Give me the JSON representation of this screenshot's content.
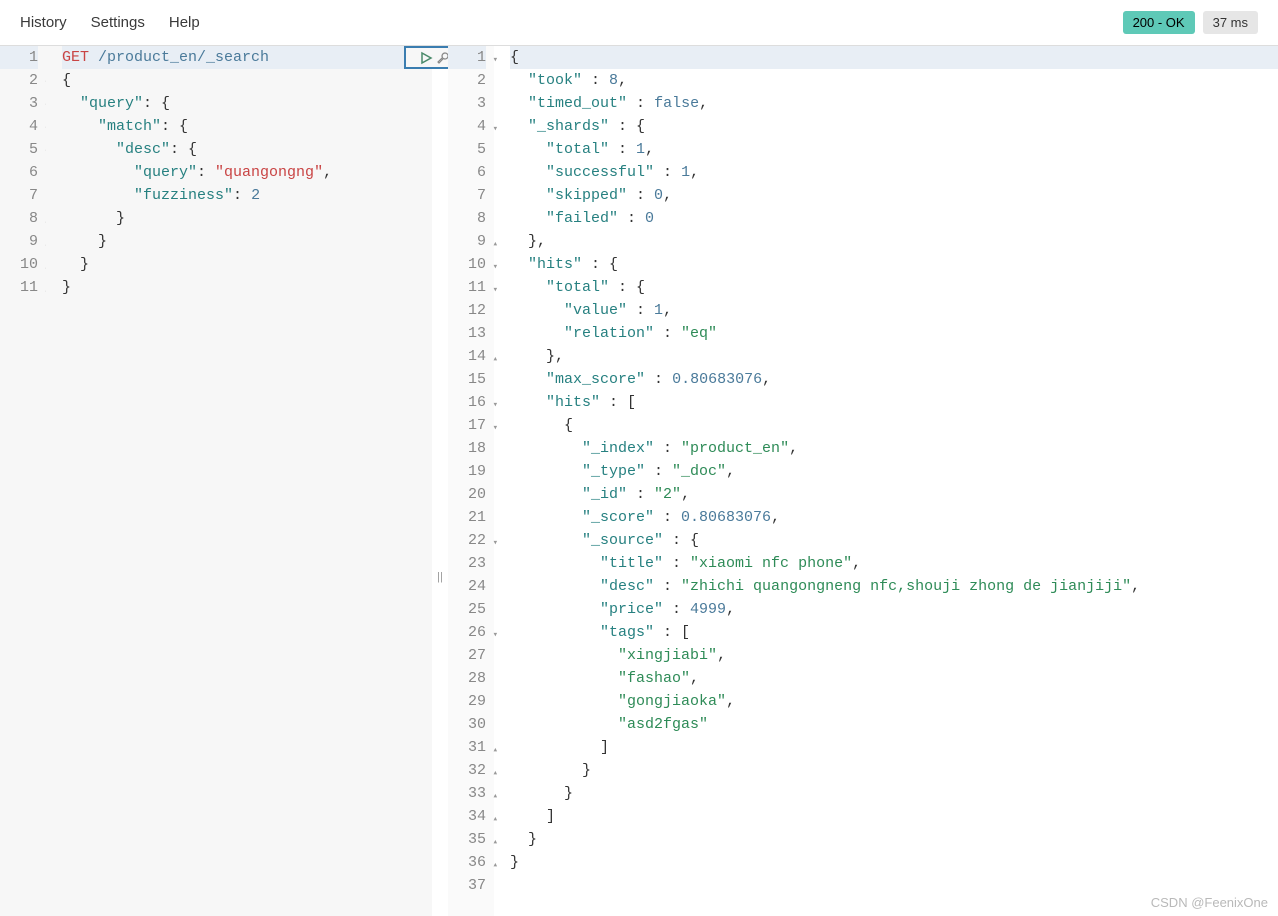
{
  "menu": {
    "history": "History",
    "settings": "Settings",
    "help": "Help"
  },
  "status": {
    "code": "200 - OK",
    "time": "37 ms"
  },
  "request": {
    "method": "GET",
    "url": "/product_en/_search",
    "lines": [
      {
        "num": 1,
        "fold": "",
        "tokens": [
          {
            "t": "GET ",
            "c": "method"
          },
          {
            "t": "/product_en/_search",
            "c": "url"
          }
        ]
      },
      {
        "num": 2,
        "fold": "▾",
        "tokens": [
          {
            "t": "{",
            "c": "brace"
          }
        ]
      },
      {
        "num": 3,
        "fold": "▾",
        "tokens": [
          {
            "t": "  ",
            "c": ""
          },
          {
            "t": "\"query\"",
            "c": "key"
          },
          {
            "t": ": {",
            "c": "brace"
          }
        ]
      },
      {
        "num": 4,
        "fold": "▾",
        "tokens": [
          {
            "t": "    ",
            "c": ""
          },
          {
            "t": "\"match\"",
            "c": "key"
          },
          {
            "t": ": {",
            "c": "brace"
          }
        ]
      },
      {
        "num": 5,
        "fold": "▾",
        "tokens": [
          {
            "t": "      ",
            "c": ""
          },
          {
            "t": "\"desc\"",
            "c": "key"
          },
          {
            "t": ": {",
            "c": "brace"
          }
        ]
      },
      {
        "num": 6,
        "fold": "",
        "tokens": [
          {
            "t": "        ",
            "c": ""
          },
          {
            "t": "\"query\"",
            "c": "key"
          },
          {
            "t": ": ",
            "c": "brace"
          },
          {
            "t": "\"quangongng\"",
            "c": "string"
          },
          {
            "t": ",",
            "c": "brace"
          }
        ]
      },
      {
        "num": 7,
        "fold": "",
        "tokens": [
          {
            "t": "        ",
            "c": ""
          },
          {
            "t": "\"fuzziness\"",
            "c": "key"
          },
          {
            "t": ": ",
            "c": "brace"
          },
          {
            "t": "2",
            "c": "number"
          }
        ]
      },
      {
        "num": 8,
        "fold": "▴",
        "tokens": [
          {
            "t": "      }",
            "c": "brace"
          }
        ]
      },
      {
        "num": 9,
        "fold": "▴",
        "tokens": [
          {
            "t": "    }",
            "c": "brace"
          }
        ]
      },
      {
        "num": 10,
        "fold": "▴",
        "tokens": [
          {
            "t": "  }",
            "c": "brace"
          }
        ]
      },
      {
        "num": 11,
        "fold": "▴",
        "tokens": [
          {
            "t": "}",
            "c": "brace"
          }
        ]
      }
    ]
  },
  "response": {
    "lines": [
      {
        "num": 1,
        "fold": "▾",
        "tokens": [
          {
            "t": "{",
            "c": "brace"
          }
        ]
      },
      {
        "num": 2,
        "fold": "",
        "tokens": [
          {
            "t": "  ",
            "c": ""
          },
          {
            "t": "\"took\"",
            "c": "key"
          },
          {
            "t": " : ",
            "c": "brace"
          },
          {
            "t": "8",
            "c": "number"
          },
          {
            "t": ",",
            "c": "brace"
          }
        ]
      },
      {
        "num": 3,
        "fold": "",
        "tokens": [
          {
            "t": "  ",
            "c": ""
          },
          {
            "t": "\"timed_out\"",
            "c": "key"
          },
          {
            "t": " : ",
            "c": "brace"
          },
          {
            "t": "false",
            "c": "bool"
          },
          {
            "t": ",",
            "c": "brace"
          }
        ]
      },
      {
        "num": 4,
        "fold": "▾",
        "tokens": [
          {
            "t": "  ",
            "c": ""
          },
          {
            "t": "\"_shards\"",
            "c": "key"
          },
          {
            "t": " : {",
            "c": "brace"
          }
        ]
      },
      {
        "num": 5,
        "fold": "",
        "tokens": [
          {
            "t": "    ",
            "c": ""
          },
          {
            "t": "\"total\"",
            "c": "key"
          },
          {
            "t": " : ",
            "c": "brace"
          },
          {
            "t": "1",
            "c": "number"
          },
          {
            "t": ",",
            "c": "brace"
          }
        ]
      },
      {
        "num": 6,
        "fold": "",
        "tokens": [
          {
            "t": "    ",
            "c": ""
          },
          {
            "t": "\"successful\"",
            "c": "key"
          },
          {
            "t": " : ",
            "c": "brace"
          },
          {
            "t": "1",
            "c": "number"
          },
          {
            "t": ",",
            "c": "brace"
          }
        ]
      },
      {
        "num": 7,
        "fold": "",
        "tokens": [
          {
            "t": "    ",
            "c": ""
          },
          {
            "t": "\"skipped\"",
            "c": "key"
          },
          {
            "t": " : ",
            "c": "brace"
          },
          {
            "t": "0",
            "c": "number"
          },
          {
            "t": ",",
            "c": "brace"
          }
        ]
      },
      {
        "num": 8,
        "fold": "",
        "tokens": [
          {
            "t": "    ",
            "c": ""
          },
          {
            "t": "\"failed\"",
            "c": "key"
          },
          {
            "t": " : ",
            "c": "brace"
          },
          {
            "t": "0",
            "c": "number"
          }
        ]
      },
      {
        "num": 9,
        "fold": "▴",
        "tokens": [
          {
            "t": "  },",
            "c": "brace"
          }
        ]
      },
      {
        "num": 10,
        "fold": "▾",
        "tokens": [
          {
            "t": "  ",
            "c": ""
          },
          {
            "t": "\"hits\"",
            "c": "key"
          },
          {
            "t": " : {",
            "c": "brace"
          }
        ]
      },
      {
        "num": 11,
        "fold": "▾",
        "tokens": [
          {
            "t": "    ",
            "c": ""
          },
          {
            "t": "\"total\"",
            "c": "key"
          },
          {
            "t": " : {",
            "c": "brace"
          }
        ]
      },
      {
        "num": 12,
        "fold": "",
        "tokens": [
          {
            "t": "      ",
            "c": ""
          },
          {
            "t": "\"value\"",
            "c": "key"
          },
          {
            "t": " : ",
            "c": "brace"
          },
          {
            "t": "1",
            "c": "number"
          },
          {
            "t": ",",
            "c": "brace"
          }
        ]
      },
      {
        "num": 13,
        "fold": "",
        "tokens": [
          {
            "t": "      ",
            "c": ""
          },
          {
            "t": "\"relation\"",
            "c": "key"
          },
          {
            "t": " : ",
            "c": "brace"
          },
          {
            "t": "\"eq\"",
            "c": "string-green"
          }
        ]
      },
      {
        "num": 14,
        "fold": "▴",
        "tokens": [
          {
            "t": "    },",
            "c": "brace"
          }
        ]
      },
      {
        "num": 15,
        "fold": "",
        "tokens": [
          {
            "t": "    ",
            "c": ""
          },
          {
            "t": "\"max_score\"",
            "c": "key"
          },
          {
            "t": " : ",
            "c": "brace"
          },
          {
            "t": "0.80683076",
            "c": "number"
          },
          {
            "t": ",",
            "c": "brace"
          }
        ]
      },
      {
        "num": 16,
        "fold": "▾",
        "tokens": [
          {
            "t": "    ",
            "c": ""
          },
          {
            "t": "\"hits\"",
            "c": "key"
          },
          {
            "t": " : [",
            "c": "brace"
          }
        ]
      },
      {
        "num": 17,
        "fold": "▾",
        "tokens": [
          {
            "t": "      {",
            "c": "brace"
          }
        ]
      },
      {
        "num": 18,
        "fold": "",
        "tokens": [
          {
            "t": "        ",
            "c": ""
          },
          {
            "t": "\"_index\"",
            "c": "key"
          },
          {
            "t": " : ",
            "c": "brace"
          },
          {
            "t": "\"product_en\"",
            "c": "string-green"
          },
          {
            "t": ",",
            "c": "brace"
          }
        ]
      },
      {
        "num": 19,
        "fold": "",
        "tokens": [
          {
            "t": "        ",
            "c": ""
          },
          {
            "t": "\"_type\"",
            "c": "key"
          },
          {
            "t": " : ",
            "c": "brace"
          },
          {
            "t": "\"_doc\"",
            "c": "string-green"
          },
          {
            "t": ",",
            "c": "brace"
          }
        ]
      },
      {
        "num": 20,
        "fold": "",
        "tokens": [
          {
            "t": "        ",
            "c": ""
          },
          {
            "t": "\"_id\"",
            "c": "key"
          },
          {
            "t": " : ",
            "c": "brace"
          },
          {
            "t": "\"2\"",
            "c": "string-green"
          },
          {
            "t": ",",
            "c": "brace"
          }
        ]
      },
      {
        "num": 21,
        "fold": "",
        "tokens": [
          {
            "t": "        ",
            "c": ""
          },
          {
            "t": "\"_score\"",
            "c": "key"
          },
          {
            "t": " : ",
            "c": "brace"
          },
          {
            "t": "0.80683076",
            "c": "number"
          },
          {
            "t": ",",
            "c": "brace"
          }
        ]
      },
      {
        "num": 22,
        "fold": "▾",
        "tokens": [
          {
            "t": "        ",
            "c": ""
          },
          {
            "t": "\"_source\"",
            "c": "key"
          },
          {
            "t": " : {",
            "c": "brace"
          }
        ]
      },
      {
        "num": 23,
        "fold": "",
        "tokens": [
          {
            "t": "          ",
            "c": ""
          },
          {
            "t": "\"title\"",
            "c": "key"
          },
          {
            "t": " : ",
            "c": "brace"
          },
          {
            "t": "\"xiaomi nfc phone\"",
            "c": "string-green"
          },
          {
            "t": ",",
            "c": "brace"
          }
        ]
      },
      {
        "num": 24,
        "fold": "",
        "tokens": [
          {
            "t": "          ",
            "c": ""
          },
          {
            "t": "\"desc\"",
            "c": "key"
          },
          {
            "t": " : ",
            "c": "brace"
          },
          {
            "t": "\"zhichi quangongneng nfc,shouji zhong de jianjiji\"",
            "c": "string-green"
          },
          {
            "t": ",",
            "c": "brace"
          }
        ]
      },
      {
        "num": 25,
        "fold": "",
        "tokens": [
          {
            "t": "          ",
            "c": ""
          },
          {
            "t": "\"price\"",
            "c": "key"
          },
          {
            "t": " : ",
            "c": "brace"
          },
          {
            "t": "4999",
            "c": "number"
          },
          {
            "t": ",",
            "c": "brace"
          }
        ]
      },
      {
        "num": 26,
        "fold": "▾",
        "tokens": [
          {
            "t": "          ",
            "c": ""
          },
          {
            "t": "\"tags\"",
            "c": "key"
          },
          {
            "t": " : [",
            "c": "brace"
          }
        ]
      },
      {
        "num": 27,
        "fold": "",
        "tokens": [
          {
            "t": "            ",
            "c": ""
          },
          {
            "t": "\"xingjiabi\"",
            "c": "string-green"
          },
          {
            "t": ",",
            "c": "brace"
          }
        ]
      },
      {
        "num": 28,
        "fold": "",
        "tokens": [
          {
            "t": "            ",
            "c": ""
          },
          {
            "t": "\"fashao\"",
            "c": "string-green"
          },
          {
            "t": ",",
            "c": "brace"
          }
        ]
      },
      {
        "num": 29,
        "fold": "",
        "tokens": [
          {
            "t": "            ",
            "c": ""
          },
          {
            "t": "\"gongjiaoka\"",
            "c": "string-green"
          },
          {
            "t": ",",
            "c": "brace"
          }
        ]
      },
      {
        "num": 30,
        "fold": "",
        "tokens": [
          {
            "t": "            ",
            "c": ""
          },
          {
            "t": "\"asd2fgas\"",
            "c": "string-green"
          }
        ]
      },
      {
        "num": 31,
        "fold": "▴",
        "tokens": [
          {
            "t": "          ]",
            "c": "brace"
          }
        ]
      },
      {
        "num": 32,
        "fold": "▴",
        "tokens": [
          {
            "t": "        }",
            "c": "brace"
          }
        ]
      },
      {
        "num": 33,
        "fold": "▴",
        "tokens": [
          {
            "t": "      }",
            "c": "brace"
          }
        ]
      },
      {
        "num": 34,
        "fold": "▴",
        "tokens": [
          {
            "t": "    ]",
            "c": "brace"
          }
        ]
      },
      {
        "num": 35,
        "fold": "▴",
        "tokens": [
          {
            "t": "  }",
            "c": "brace"
          }
        ]
      },
      {
        "num": 36,
        "fold": "▴",
        "tokens": [
          {
            "t": "}",
            "c": "brace"
          }
        ]
      },
      {
        "num": 37,
        "fold": "",
        "tokens": []
      }
    ]
  },
  "watermark": "CSDN @FeenixOne"
}
